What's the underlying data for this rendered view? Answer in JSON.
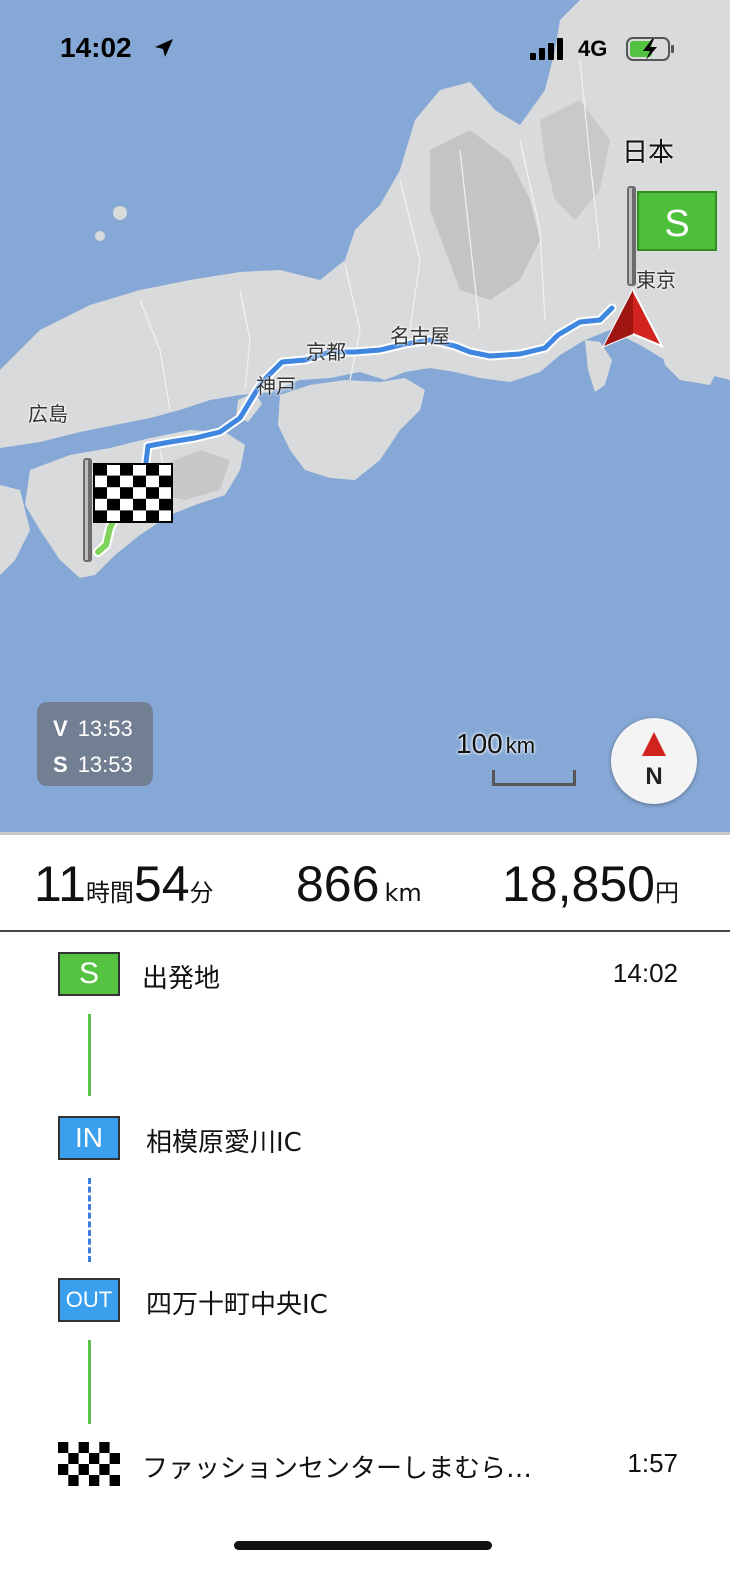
{
  "status_bar": {
    "time": "14:02",
    "network": "4G",
    "icons": [
      "location-arrow-icon",
      "signal-icon",
      "battery-charging-icon"
    ]
  },
  "map": {
    "country_label": "日本",
    "cities": {
      "hiroshima": "広島",
      "kobe": "神戸",
      "kyoto": "京都",
      "nagoya": "名古屋",
      "tokyo": "東京"
    },
    "start_flag_letter": "S",
    "time_badge": {
      "v_label": "V",
      "v_time": "13:53",
      "s_label": "S",
      "s_time": "13:53"
    },
    "scale": {
      "value": "100",
      "unit": "km"
    },
    "compass_label": "N",
    "colors": {
      "sea": "#86a8d6",
      "land": "#d9dadb",
      "route_highway": "#3f86e0",
      "route_local": "#7fd35a"
    }
  },
  "summary": {
    "hours": "11",
    "hours_unit": "時間",
    "minutes": "54",
    "minutes_unit": "分",
    "distance": "866",
    "distance_unit": "km",
    "toll": "18,850",
    "toll_unit": "円"
  },
  "route": [
    {
      "badge": "S",
      "type": "start",
      "name": "出発地",
      "time": "14:02"
    },
    {
      "badge": "IN",
      "type": "in",
      "name": "相模原愛川IC",
      "time": ""
    },
    {
      "badge": "OUT",
      "type": "out",
      "name": "四万十町中央IC",
      "time": ""
    },
    {
      "badge": "",
      "type": "goal",
      "name": "ファッションセンターしまむら…",
      "time": "1:57"
    }
  ],
  "colors": {
    "start_badge": "#55c241",
    "ic_badge": "#3aa0ee",
    "local_segment": "#5cc24a",
    "highway_segment": "#3d7ee0"
  }
}
